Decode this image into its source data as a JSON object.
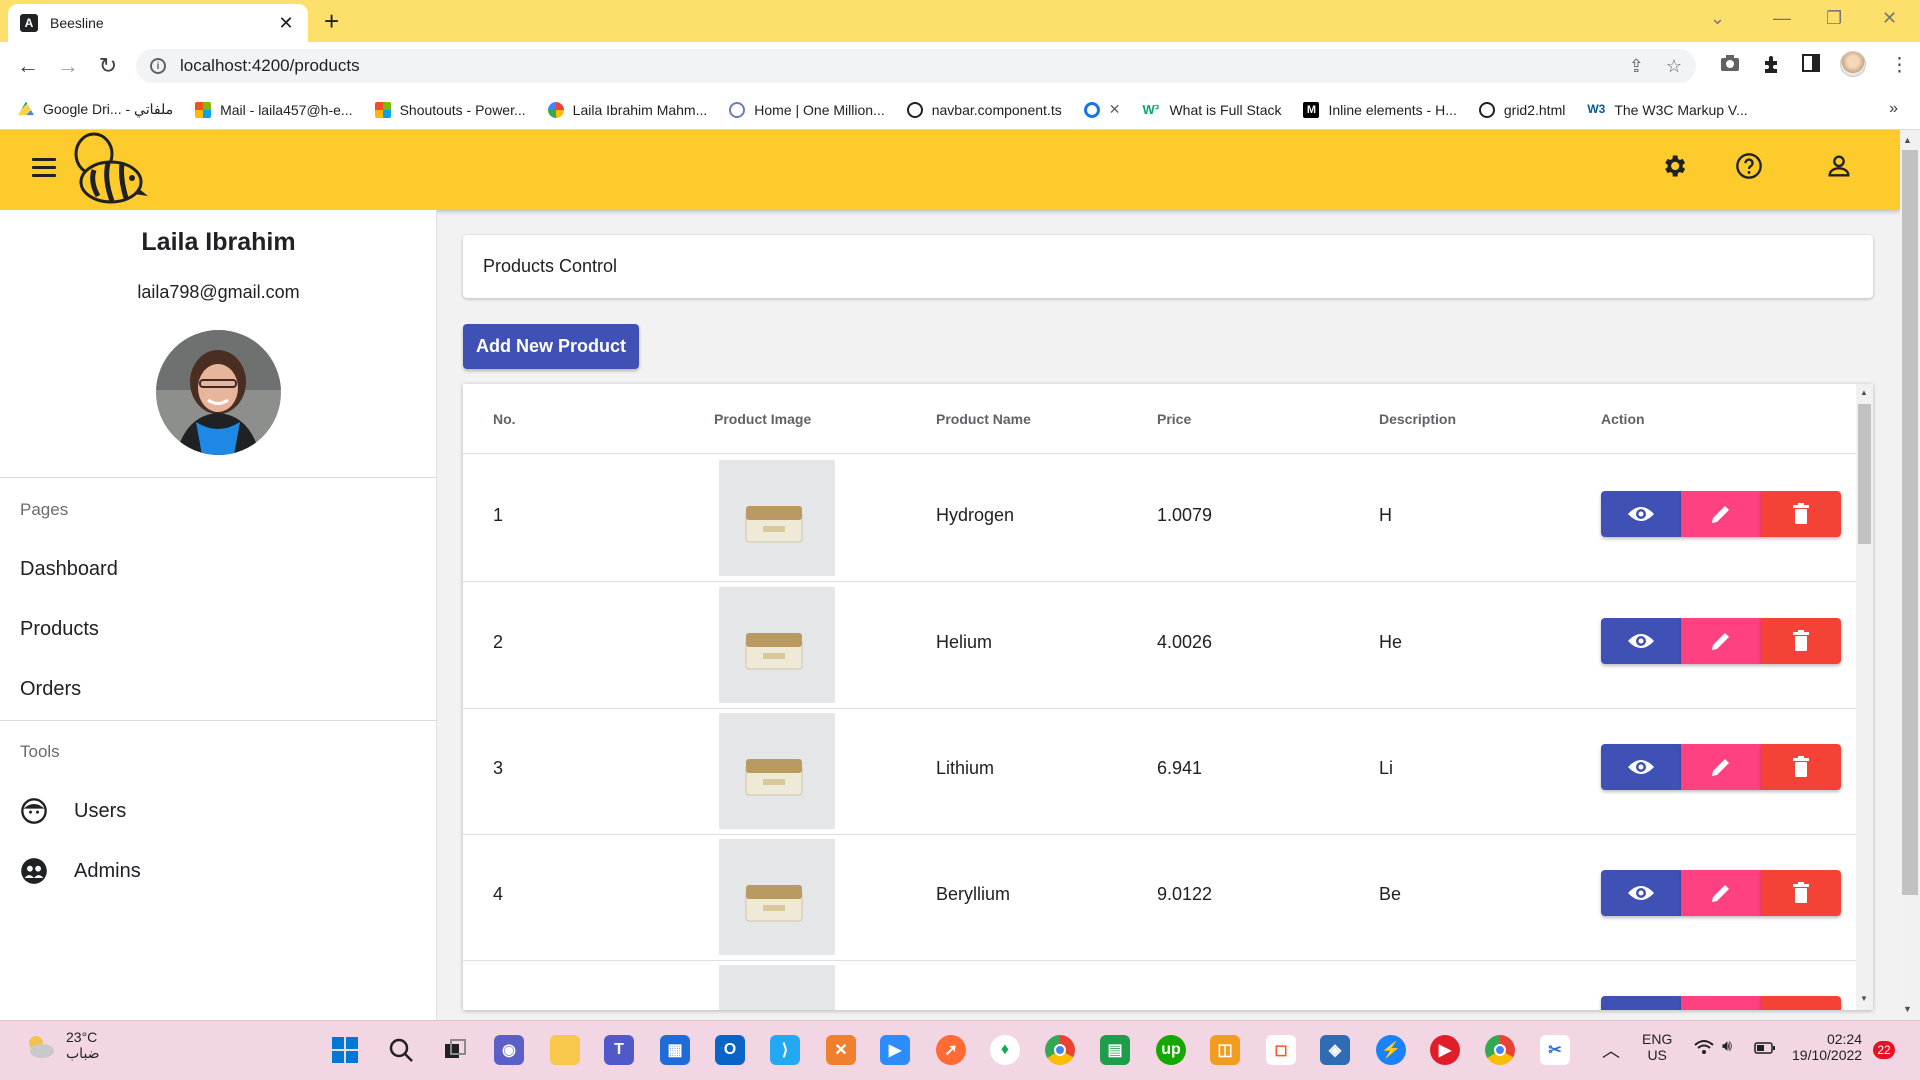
{
  "browser": {
    "tab_title": "Beesline",
    "url": "localhost:4200/products",
    "bookmarks": [
      {
        "label": "Google Dri... - ملفاتي",
        "color": "#1fa463"
      },
      {
        "label": "Mail - laila457@h-e...",
        "color": "#f25022"
      },
      {
        "label": "Shoutouts - Power...",
        "color": "#f25022"
      },
      {
        "label": "Laila Ibrahim Mahm...",
        "color": "#fbbc04"
      },
      {
        "label": "Home | One Million...",
        "color": "#6b7cb8"
      },
      {
        "label": "navbar.component.ts",
        "color": "#202124"
      },
      {
        "label": "",
        "color": "#1a73e8"
      },
      {
        "label": "What is Full Stack",
        "color": "#04aa6d"
      },
      {
        "label": "Inline elements - H...",
        "color": "#000000"
      },
      {
        "label": "grid2.html",
        "color": "#202124"
      },
      {
        "label": "The W3C Markup V...",
        "color": "#005a9c"
      }
    ]
  },
  "header": {
    "icons": [
      "settings-icon",
      "help-icon",
      "account-icon"
    ],
    "brand_color": "#fdcb2c"
  },
  "sidebar": {
    "user_name": "Laila Ibrahim",
    "user_email": "laila798@gmail.com",
    "pages_heading": "Pages",
    "pages": [
      "Dashboard",
      "Products",
      "Orders"
    ],
    "tools_heading": "Tools",
    "tools": [
      {
        "label": "Users",
        "icon": "user-face-icon"
      },
      {
        "label": "Admins",
        "icon": "admins-icon"
      }
    ]
  },
  "main": {
    "card_title": "Products Control",
    "add_button": "Add New Product",
    "columns": [
      "No.",
      "Product Image",
      "Product Name",
      "Price",
      "Description",
      "Action"
    ],
    "rows": [
      {
        "no": "1",
        "name": "Hydrogen",
        "price": "1.0079",
        "description": "H"
      },
      {
        "no": "2",
        "name": "Helium",
        "price": "4.0026",
        "description": "He"
      },
      {
        "no": "3",
        "name": "Lithium",
        "price": "6.941",
        "description": "Li"
      },
      {
        "no": "4",
        "name": "Beryllium",
        "price": "9.0122",
        "description": "Be"
      }
    ],
    "action_colors": {
      "view": "#3f51b5",
      "edit": "#ff4081",
      "delete": "#f44336"
    }
  },
  "taskbar": {
    "temperature": "23°C",
    "weather": "ضباب",
    "language": "ENG",
    "region": "US",
    "time": "02:24",
    "date": "19/10/2022",
    "notifications": "22"
  }
}
